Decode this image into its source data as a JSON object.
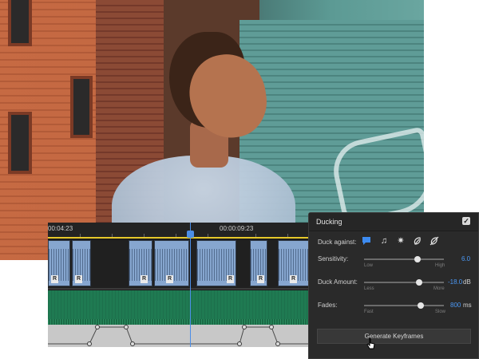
{
  "timeline": {
    "timecode_start": "00:04:23",
    "timecode_mid": "00:00:09:23",
    "clip_badge": "R",
    "playhead_color": "#4b8ee8",
    "work_area_color": "#e6c82a",
    "video_clip_color": "#86a6cf",
    "music_track_color": "#1f7a52"
  },
  "panel": {
    "title": "Ducking",
    "enabled_checkbox": "✓",
    "duck_against_label": "Duck against:",
    "duck_against_icons": [
      "dialogue-icon",
      "music-icon",
      "sfx-icon",
      "ambience-icon",
      "auto-match-icon"
    ],
    "sensitivity": {
      "label": "Sensitivity:",
      "min_label": "Low",
      "max_label": "High",
      "value": "6.0",
      "fraction": 0.67
    },
    "duck_amount": {
      "label": "Duck Amount:",
      "min_label": "Less",
      "max_label": "More",
      "value": "-18.0",
      "unit": "dB",
      "fraction": 0.69
    },
    "fades": {
      "label": "Fades:",
      "min_label": "Fast",
      "max_label": "Slow",
      "value": "800",
      "unit": "ms",
      "fraction": 0.71
    },
    "generate_button": "Generate Keyframes"
  },
  "colors": {
    "accent": "#4b98f5",
    "panel_bg": "#2a2a2a"
  }
}
